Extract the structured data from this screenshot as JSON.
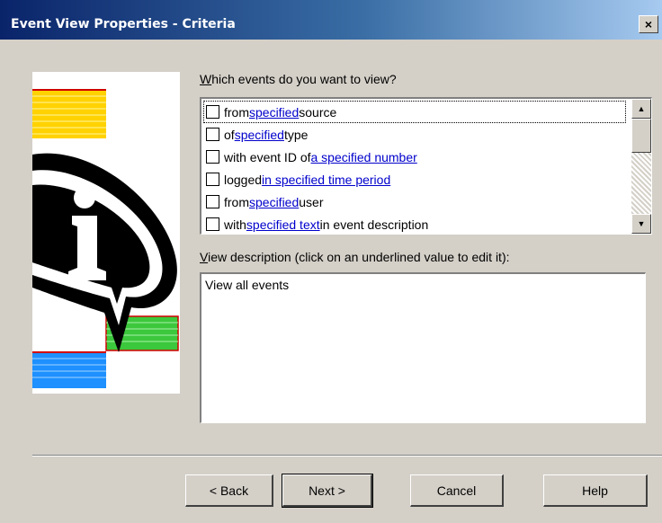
{
  "window": {
    "title": "Event View Properties - Criteria",
    "close_glyph": "×"
  },
  "prompt": {
    "pre": "",
    "accel": "W",
    "post": "hich events do you want to view?"
  },
  "criteria": [
    {
      "pre": "from ",
      "link": "specified",
      "post": " source",
      "link2": "",
      "post2": ""
    },
    {
      "pre": "of ",
      "link": "specified",
      "post": " type",
      "link2": "",
      "post2": ""
    },
    {
      "pre": "with event ID of ",
      "link": "a specified number",
      "post": "",
      "link2": "",
      "post2": ""
    },
    {
      "pre": "logged ",
      "link": "in specified time period",
      "post": "",
      "link2": "",
      "post2": ""
    },
    {
      "pre": "from ",
      "link": "specified",
      "post": " user",
      "link2": "",
      "post2": ""
    },
    {
      "pre": "with ",
      "link": "specified text",
      "post": " in event description",
      "link2": "",
      "post2": ""
    }
  ],
  "description": {
    "label_accel": "V",
    "label_rest": "iew description (click on an underlined value to edit it):",
    "value": "View all events"
  },
  "buttons": {
    "back": "< Back",
    "next": "Next >",
    "cancel": "Cancel",
    "help": "Help"
  },
  "colors": {
    "link": "#0000cc",
    "titlebar": "#0a246a",
    "face": "#d4d0c8"
  }
}
